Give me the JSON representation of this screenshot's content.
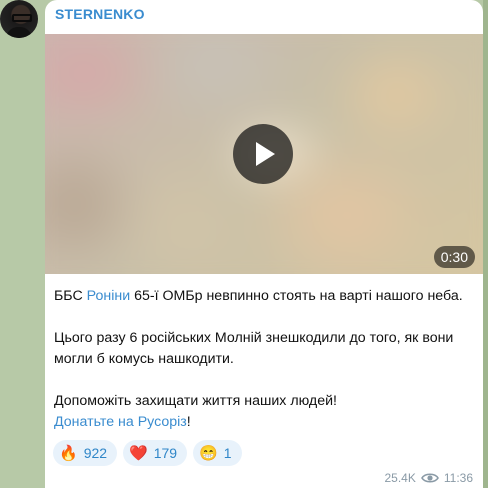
{
  "channel": {
    "name": "STERNENKO"
  },
  "video": {
    "duration": "0:30"
  },
  "message": {
    "p1_prefix": "ББС ",
    "p1_link": "Роніни",
    "p1_suffix": " 65-ї ОМБр невпинно стоять на варті нашого неба.",
    "p2": "Цього разу 6 російських Молній знешкодили до того, як вони могли б комусь нашкодити.",
    "p3": "Допоможіть захищати життя наших людей!",
    "p4_link": "Донатьте на Русоріз",
    "p4_suffix": "!"
  },
  "reactions": [
    {
      "emoji": "🔥",
      "count": "922"
    },
    {
      "emoji": "❤️",
      "count": "179"
    },
    {
      "emoji": "😁",
      "count": "1"
    }
  ],
  "footer": {
    "views": "25.4K",
    "time": "11:36",
    "views_icon": "eye-icon"
  }
}
